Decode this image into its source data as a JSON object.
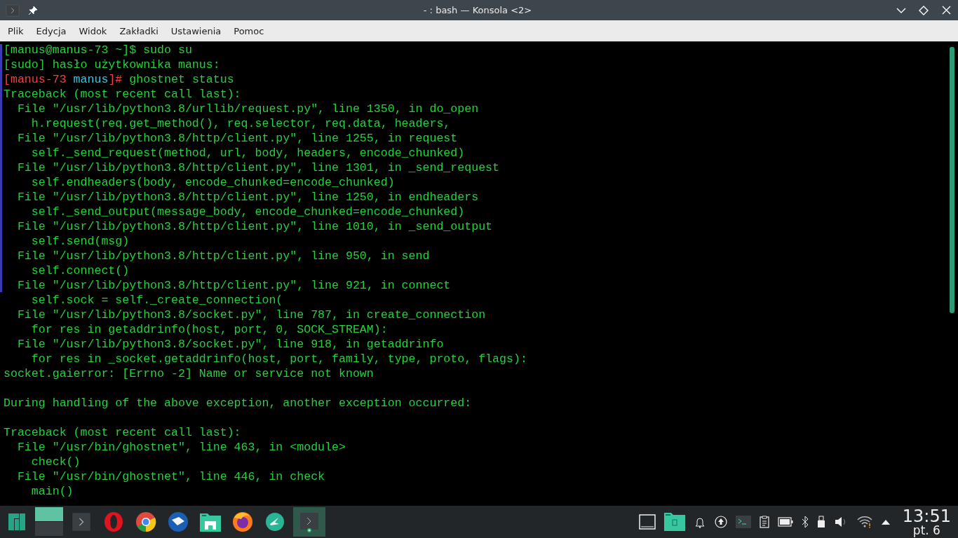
{
  "window": {
    "title": "- : bash — Konsola <2>"
  },
  "menu": [
    "Plik",
    "Edycja",
    "Widok",
    "Zakładki",
    "Ustawienia",
    "Pomoc"
  ],
  "terminal": {
    "lines": [
      [
        {
          "kind": "output",
          "text": "[manus@manus-73 ~]$ sudo su"
        }
      ],
      [
        {
          "kind": "output",
          "text": "[sudo] hasło użytkownika manus:"
        }
      ],
      [
        {
          "kind": "root-host",
          "text": "[manus-73"
        },
        {
          "kind": "root-user",
          "text": " manus"
        },
        {
          "kind": "root-host",
          "text": "]#"
        },
        {
          "kind": "output",
          "text": " ghostnet status"
        }
      ],
      [
        {
          "kind": "output",
          "text": "Traceback (most recent call last):"
        }
      ],
      [
        {
          "kind": "output",
          "text": "  File \"/usr/lib/python3.8/urllib/request.py\", line 1350, in do_open"
        }
      ],
      [
        {
          "kind": "output",
          "text": "    h.request(req.get_method(), req.selector, req.data, headers,"
        }
      ],
      [
        {
          "kind": "output",
          "text": "  File \"/usr/lib/python3.8/http/client.py\", line 1255, in request"
        }
      ],
      [
        {
          "kind": "output",
          "text": "    self._send_request(method, url, body, headers, encode_chunked)"
        }
      ],
      [
        {
          "kind": "output",
          "text": "  File \"/usr/lib/python3.8/http/client.py\", line 1301, in _send_request"
        }
      ],
      [
        {
          "kind": "output",
          "text": "    self.endheaders(body, encode_chunked=encode_chunked)"
        }
      ],
      [
        {
          "kind": "output",
          "text": "  File \"/usr/lib/python3.8/http/client.py\", line 1250, in endheaders"
        }
      ],
      [
        {
          "kind": "output",
          "text": "    self._send_output(message_body, encode_chunked=encode_chunked)"
        }
      ],
      [
        {
          "kind": "output",
          "text": "  File \"/usr/lib/python3.8/http/client.py\", line 1010, in _send_output"
        }
      ],
      [
        {
          "kind": "output",
          "text": "    self.send(msg)"
        }
      ],
      [
        {
          "kind": "output",
          "text": "  File \"/usr/lib/python3.8/http/client.py\", line 950, in send"
        }
      ],
      [
        {
          "kind": "output",
          "text": "    self.connect()"
        }
      ],
      [
        {
          "kind": "output",
          "text": "  File \"/usr/lib/python3.8/http/client.py\", line 921, in connect"
        }
      ],
      [
        {
          "kind": "output",
          "text": "    self.sock = self._create_connection("
        }
      ],
      [
        {
          "kind": "output",
          "text": "  File \"/usr/lib/python3.8/socket.py\", line 787, in create_connection"
        }
      ],
      [
        {
          "kind": "output",
          "text": "    for res in getaddrinfo(host, port, 0, SOCK_STREAM):"
        }
      ],
      [
        {
          "kind": "output",
          "text": "  File \"/usr/lib/python3.8/socket.py\", line 918, in getaddrinfo"
        }
      ],
      [
        {
          "kind": "output",
          "text": "    for res in _socket.getaddrinfo(host, port, family, type, proto, flags):"
        }
      ],
      [
        {
          "kind": "output",
          "text": "socket.gaierror: [Errno -2] Name or service not known"
        }
      ],
      [
        {
          "kind": "blank"
        }
      ],
      [
        {
          "kind": "output",
          "text": "During handling of the above exception, another exception occurred:"
        }
      ],
      [
        {
          "kind": "blank"
        }
      ],
      [
        {
          "kind": "output",
          "text": "Traceback (most recent call last):"
        }
      ],
      [
        {
          "kind": "output",
          "text": "  File \"/usr/bin/ghostnet\", line 463, in <module>"
        }
      ],
      [
        {
          "kind": "output",
          "text": "    check()"
        }
      ],
      [
        {
          "kind": "output",
          "text": "  File \"/usr/bin/ghostnet\", line 446, in check"
        }
      ],
      [
        {
          "kind": "output",
          "text": "    main()"
        }
      ]
    ]
  },
  "taskbar": {
    "clock": {
      "time": "13:51",
      "date": "pt. 6"
    }
  }
}
